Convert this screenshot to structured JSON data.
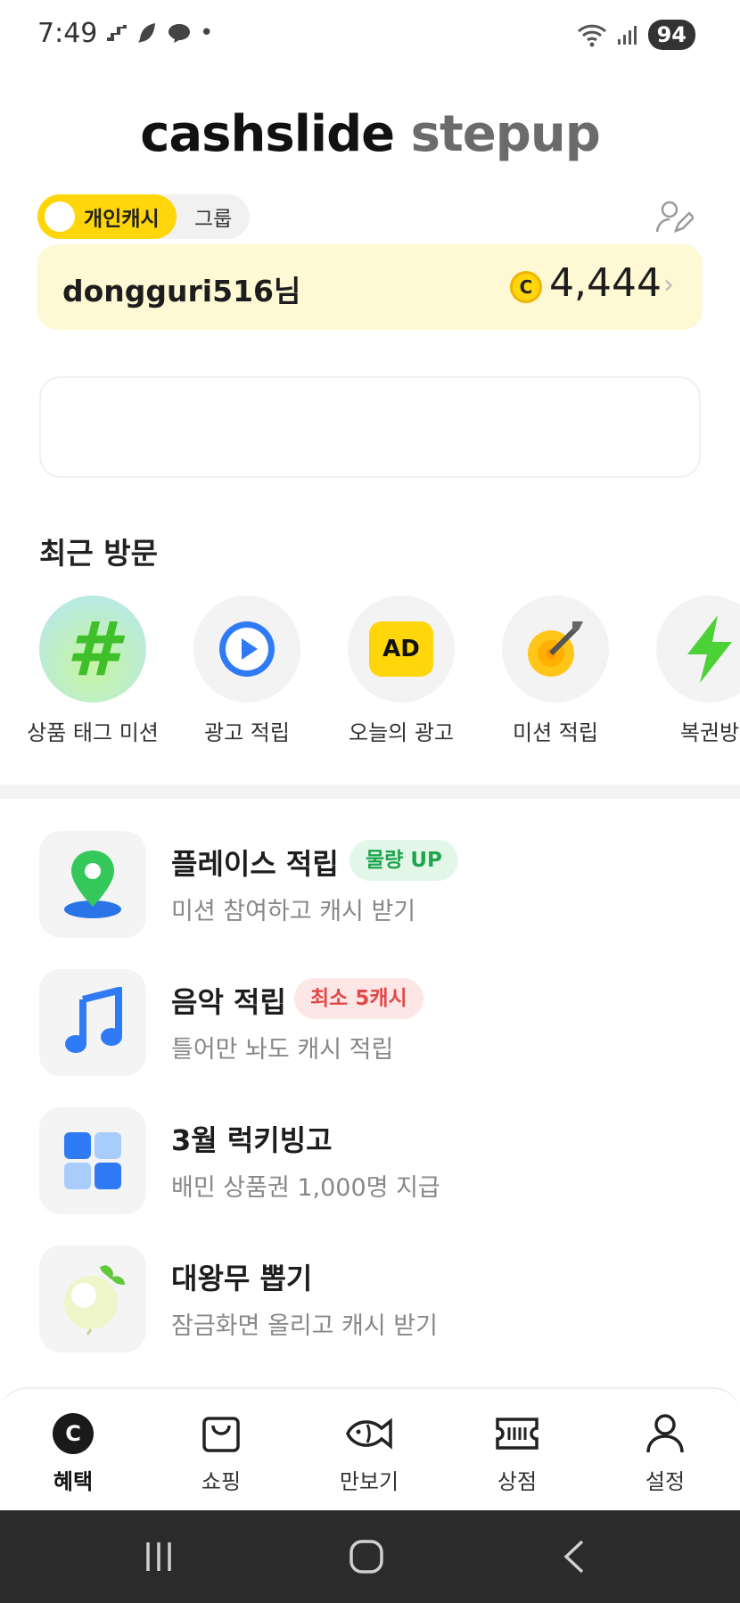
{
  "status_bar": {
    "time": "7:49",
    "battery": "94",
    "dot": "•"
  },
  "logo": {
    "main": "cashslide",
    "sub": "stepup"
  },
  "cash_toggle": {
    "personal_label": "개인캐시",
    "group_label": "그룹"
  },
  "user_card": {
    "username": "dongguri516님",
    "coin_symbol": "C",
    "cash_amount": "4,444",
    "chevron": "›"
  },
  "recent_visits": {
    "title": "최근 방문",
    "items": [
      {
        "label": "상품 태그 미션",
        "icon": "hash-icon"
      },
      {
        "label": "광고 적립",
        "icon": "play-icon"
      },
      {
        "label": "오늘의 광고",
        "icon": "ad-icon"
      },
      {
        "label": "미션 적립",
        "icon": "target-icon"
      },
      {
        "label": "복권방",
        "icon": "lightning-icon"
      }
    ],
    "ad_icon_text": "AD",
    "hash_icon_text": "#"
  },
  "features": [
    {
      "title": "플레이스 적립",
      "badge": "물량 UP",
      "subtitle": "미션 참여하고 캐시 받기",
      "icon": "location-pin-icon"
    },
    {
      "title": "음악 적립",
      "badge": "최소 5캐시",
      "subtitle": "틀어만 놔도 캐시 적립",
      "icon": "music-note-icon"
    },
    {
      "title": "3월 럭키빙고",
      "badge": "",
      "subtitle": "배민 상품권 1,000명 지급",
      "icon": "bingo-grid-icon"
    },
    {
      "title": "대왕무 뽑기",
      "badge": "",
      "subtitle": "잠금화면 올리고 캐시 받기",
      "icon": "radish-icon"
    }
  ],
  "bottom_nav": {
    "items": [
      {
        "label": "혜택",
        "icon": "benefit-coin-icon",
        "active": true
      },
      {
        "label": "쇼핑",
        "icon": "shopping-bag-icon",
        "active": false
      },
      {
        "label": "만보기",
        "icon": "fish-icon",
        "active": false
      },
      {
        "label": "상점",
        "icon": "ticket-icon",
        "active": false
      },
      {
        "label": "설정",
        "icon": "person-icon",
        "active": false
      }
    ],
    "benefit_icon_text": "C"
  },
  "colors": {
    "accent_yellow": "#ffd60a",
    "card_bg": "#fff8d4",
    "badge_green": "#1fa54e",
    "badge_red": "#e04949"
  }
}
